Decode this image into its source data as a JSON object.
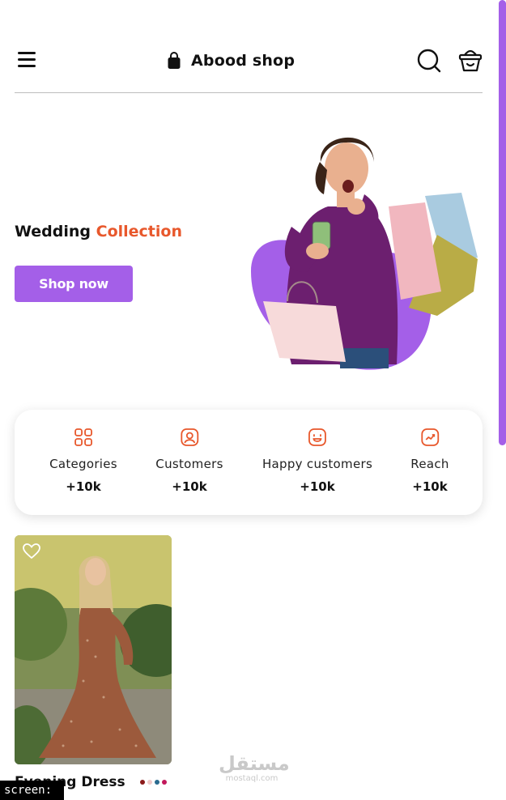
{
  "header": {
    "brand_name": "Abood shop",
    "icons": [
      "menu-icon",
      "shopping-bag-icon",
      "search-icon",
      "basket-icon"
    ]
  },
  "hero": {
    "title_part1": "Wedding",
    "title_part2": "Collection",
    "button_label": "Shop now",
    "accent_color": "#e8582c",
    "brand_color": "#a45fe8"
  },
  "stats": [
    {
      "icon": "categories-grid-icon",
      "label": "Categories",
      "value": "+10k"
    },
    {
      "icon": "customer-user-icon",
      "label": "Customers",
      "value": "+10k"
    },
    {
      "icon": "happy-face-icon",
      "label": "Happy customers",
      "value": "+10k"
    },
    {
      "icon": "reach-trend-icon",
      "label": "Reach",
      "value": "+10k"
    }
  ],
  "product": {
    "name": "Evening Dress",
    "swatch_colors": [
      "#8b1a1a",
      "#f0c9c9",
      "#2b6b8f",
      "#c2185b"
    ]
  },
  "watermark": {
    "arabic": "مستقل",
    "latin": "mostaql.com"
  },
  "screen_label": "screen: _"
}
